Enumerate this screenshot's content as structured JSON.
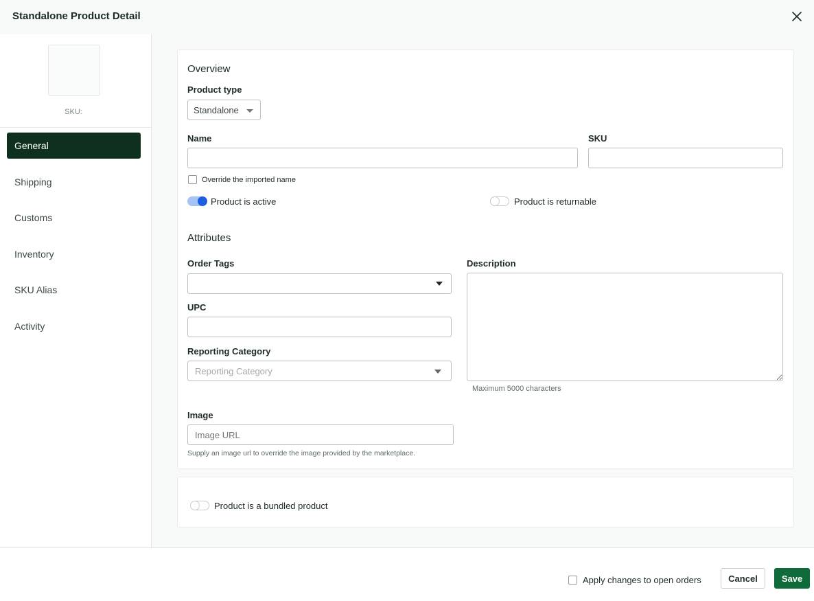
{
  "header": {
    "title": "Standalone Product Detail",
    "close_icon": "close-icon"
  },
  "sidebar": {
    "sku_label": "SKU:",
    "items": [
      {
        "label": "General",
        "active": true
      },
      {
        "label": "Shipping",
        "active": false
      },
      {
        "label": "Customs",
        "active": false
      },
      {
        "label": "Inventory",
        "active": false
      },
      {
        "label": "SKU Alias",
        "active": false
      },
      {
        "label": "Activity",
        "active": false
      }
    ]
  },
  "overview": {
    "title": "Overview",
    "product_type_label": "Product type",
    "product_type_value": "Standalone",
    "name_label": "Name",
    "name_value": "",
    "sku_label": "SKU",
    "sku_value": "",
    "override_label": "Override the imported name",
    "override_checked": false,
    "active_label": "Product is active",
    "active_on": true,
    "returnable_label": "Product is returnable",
    "returnable_on": false
  },
  "attributes": {
    "title": "Attributes",
    "order_tags_label": "Order Tags",
    "upc_label": "UPC",
    "reporting_category_label": "Reporting Category",
    "reporting_category_placeholder": "Reporting Category",
    "description_label": "Description",
    "description_help": "Maximum 5000 characters",
    "image_label": "Image",
    "image_placeholder": "Image URL",
    "image_help": "Supply an image url to override the image provided by the marketplace."
  },
  "bundle": {
    "label": "Product is a bundled product",
    "on": false
  },
  "footer": {
    "apply_label": "Apply changes to open orders",
    "apply_checked": false,
    "cancel_label": "Cancel",
    "save_label": "Save"
  },
  "colors": {
    "accent": "#0f6b3a",
    "nav_active": "#10301f",
    "toggle_on": "#1c5fe0"
  }
}
